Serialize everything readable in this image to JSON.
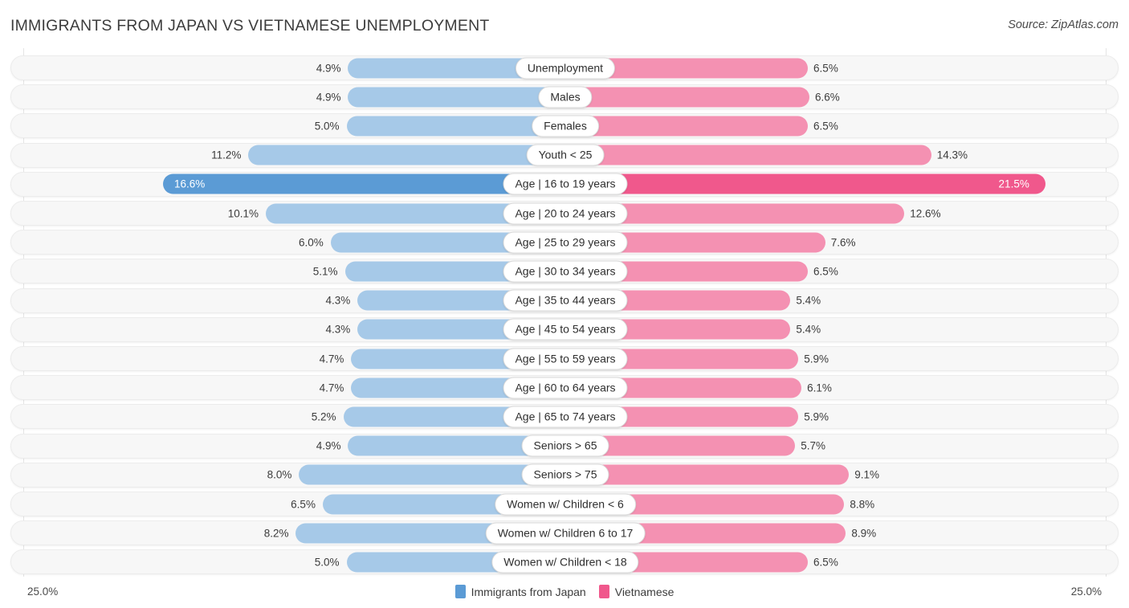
{
  "header": {
    "title": "IMMIGRANTS FROM JAPAN VS VIETNAMESE UNEMPLOYMENT",
    "source": "Source: ZipAtlas.com"
  },
  "axis": {
    "left_label": "25.0%",
    "right_label": "25.0%",
    "max": 25.0
  },
  "legend": {
    "items": [
      {
        "label": "Immigrants from Japan",
        "color": "#5b9bd5"
      },
      {
        "label": "Vietnamese",
        "color": "#f0588c"
      }
    ]
  },
  "colors": {
    "left_normal": "#a6c9e8",
    "left_highlight": "#5b9bd5",
    "right_normal": "#f491b2",
    "right_highlight": "#f0588c",
    "row_bg": "#f7f7f7",
    "row_border": "#ececec",
    "pill_bg": "#ffffff",
    "text": "#3c3c3c"
  },
  "chart_data": {
    "type": "bar",
    "orientation": "horizontal-diverging",
    "title": "IMMIGRANTS FROM JAPAN VS VIETNAMESE UNEMPLOYMENT",
    "xlabel": "",
    "ylabel": "",
    "xlim": [
      -25.0,
      25.0
    ],
    "grid": false,
    "legend_position": "bottom-center",
    "series": [
      {
        "name": "Immigrants from Japan",
        "side": "left",
        "color": "#a6c9e8",
        "values": [
          4.9,
          4.9,
          5.0,
          11.2,
          16.6,
          10.1,
          6.0,
          5.1,
          4.3,
          4.3,
          4.7,
          4.7,
          5.2,
          4.9,
          8.0,
          6.5,
          8.2,
          5.0
        ]
      },
      {
        "name": "Vietnamese",
        "side": "right",
        "color": "#f491b2",
        "values": [
          6.5,
          6.6,
          6.5,
          14.3,
          21.5,
          12.6,
          7.6,
          6.5,
          5.4,
          5.4,
          5.9,
          6.1,
          5.9,
          5.7,
          9.1,
          8.8,
          8.9,
          6.5
        ]
      }
    ],
    "categories": [
      "Unemployment",
      "Males",
      "Females",
      "Youth < 25",
      "Age | 16 to 19 years",
      "Age | 20 to 24 years",
      "Age | 25 to 29 years",
      "Age | 30 to 34 years",
      "Age | 35 to 44 years",
      "Age | 45 to 54 years",
      "Age | 55 to 59 years",
      "Age | 60 to 64 years",
      "Age | 65 to 74 years",
      "Seniors > 65",
      "Seniors > 75",
      "Women w/ Children < 6",
      "Women w/ Children 6 to 17",
      "Women w/ Children < 18"
    ],
    "highlighted_category": "Age | 16 to 19 years"
  },
  "rows": [
    {
      "label": "Unemployment",
      "left": "4.9%",
      "right": "6.5%",
      "lv": 4.9,
      "rv": 6.5,
      "hl": false
    },
    {
      "label": "Males",
      "left": "4.9%",
      "right": "6.6%",
      "lv": 4.9,
      "rv": 6.6,
      "hl": false
    },
    {
      "label": "Females",
      "left": "5.0%",
      "right": "6.5%",
      "lv": 5.0,
      "rv": 6.5,
      "hl": false
    },
    {
      "label": "Youth < 25",
      "left": "11.2%",
      "right": "14.3%",
      "lv": 11.2,
      "rv": 14.3,
      "hl": false
    },
    {
      "label": "Age | 16 to 19 years",
      "left": "16.6%",
      "right": "21.5%",
      "lv": 16.6,
      "rv": 21.5,
      "hl": true
    },
    {
      "label": "Age | 20 to 24 years",
      "left": "10.1%",
      "right": "12.6%",
      "lv": 10.1,
      "rv": 12.6,
      "hl": false
    },
    {
      "label": "Age | 25 to 29 years",
      "left": "6.0%",
      "right": "7.6%",
      "lv": 6.0,
      "rv": 7.6,
      "hl": false
    },
    {
      "label": "Age | 30 to 34 years",
      "left": "5.1%",
      "right": "6.5%",
      "lv": 5.1,
      "rv": 6.5,
      "hl": false
    },
    {
      "label": "Age | 35 to 44 years",
      "left": "4.3%",
      "right": "5.4%",
      "lv": 4.3,
      "rv": 5.4,
      "hl": false
    },
    {
      "label": "Age | 45 to 54 years",
      "left": "4.3%",
      "right": "5.4%",
      "lv": 4.3,
      "rv": 5.4,
      "hl": false
    },
    {
      "label": "Age | 55 to 59 years",
      "left": "4.7%",
      "right": "5.9%",
      "lv": 4.7,
      "rv": 5.9,
      "hl": false
    },
    {
      "label": "Age | 60 to 64 years",
      "left": "4.7%",
      "right": "6.1%",
      "lv": 4.7,
      "rv": 6.1,
      "hl": false
    },
    {
      "label": "Age | 65 to 74 years",
      "left": "5.2%",
      "right": "5.9%",
      "lv": 5.2,
      "rv": 5.9,
      "hl": false
    },
    {
      "label": "Seniors > 65",
      "left": "4.9%",
      "right": "5.7%",
      "lv": 4.9,
      "rv": 5.7,
      "hl": false
    },
    {
      "label": "Seniors > 75",
      "left": "8.0%",
      "right": "9.1%",
      "lv": 8.0,
      "rv": 9.1,
      "hl": false
    },
    {
      "label": "Women w/ Children < 6",
      "left": "6.5%",
      "right": "8.8%",
      "lv": 6.5,
      "rv": 8.8,
      "hl": false
    },
    {
      "label": "Women w/ Children 6 to 17",
      "left": "8.2%",
      "right": "8.9%",
      "lv": 8.2,
      "rv": 8.9,
      "hl": false
    },
    {
      "label": "Women w/ Children < 18",
      "left": "5.0%",
      "right": "6.5%",
      "lv": 5.0,
      "rv": 6.5,
      "hl": false
    }
  ]
}
